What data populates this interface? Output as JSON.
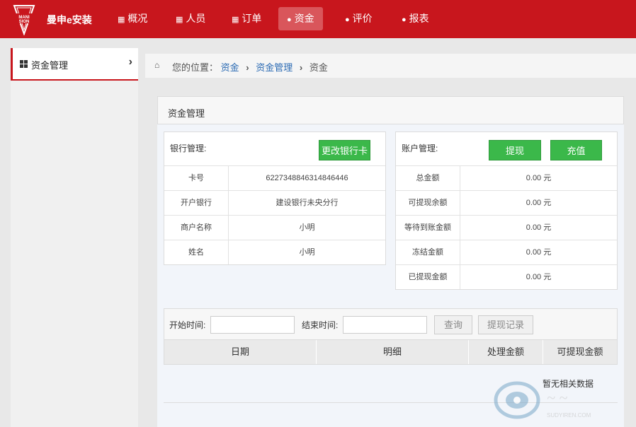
{
  "header": {
    "brand": "曼申e安装",
    "logo_text": "MANISION",
    "nav": [
      {
        "label": "概况",
        "icon": "table-icon"
      },
      {
        "label": "人员",
        "icon": "grid-icon"
      },
      {
        "label": "订单",
        "icon": "grid-icon"
      },
      {
        "label": "资金",
        "icon": "comments-icon",
        "active": true
      },
      {
        "label": "评价",
        "icon": "comments-icon"
      },
      {
        "label": "报表",
        "icon": "comments-icon"
      }
    ],
    "accent_color": "#c8161d"
  },
  "sidebar": {
    "items": [
      {
        "label": "资金管理",
        "icon": "grid-icon"
      }
    ]
  },
  "breadcrumb": {
    "prefix": "您的位置：",
    "items": [
      "资金",
      "资金管理",
      "资金"
    ]
  },
  "panel": {
    "title": "资金管理"
  },
  "bank": {
    "title": "银行管理:",
    "button": "更改银行卡",
    "rows": [
      {
        "label": "卡号",
        "value": "6227348846314846446"
      },
      {
        "label": "开户银行",
        "value": "建设银行未央分行"
      },
      {
        "label": "商户名称",
        "value": "小明"
      },
      {
        "label": "姓名",
        "value": "小明"
      }
    ]
  },
  "account": {
    "title": "账户管理:",
    "withdraw_button": "提现",
    "recharge_button": "充值",
    "rows": [
      {
        "label": "总金额",
        "value": "0.00 元"
      },
      {
        "label": "可提现余额",
        "value": "0.00 元"
      },
      {
        "label": "等待到账金额",
        "value": "0.00 元"
      },
      {
        "label": "冻结金额",
        "value": "0.00 元"
      },
      {
        "label": "已提现金额",
        "value": "0.00 元"
      }
    ]
  },
  "query": {
    "start_label": "开始时间:",
    "start_value": "",
    "end_label": "结束时间:",
    "end_value": "",
    "search_button": "查询",
    "records_button": "提现记录",
    "columns": [
      "日期",
      "明细",
      "处理金额",
      "可提现金额"
    ],
    "empty_text": "暂无相关数据"
  },
  "watermark": {
    "text": "SUDYIREN.COM"
  }
}
